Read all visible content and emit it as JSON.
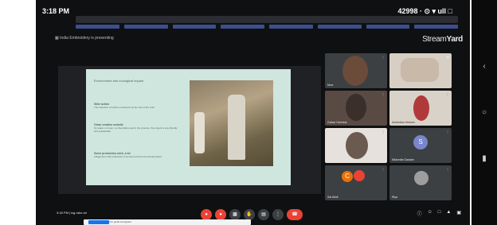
{
  "status_bar": {
    "time": "3:18 PM",
    "right_text": "42998 · ⊙ ▾ ull □"
  },
  "meet": {
    "presenting_label": "India Embroidery is presenting",
    "brand_prefix": "Stream",
    "brand_suffix": "Yard"
  },
  "slide": {
    "title": "Environment and ecological impact",
    "sections": [
      {
        "heading": "Slide action",
        "body": "The reduction of carbon emissions by the use of the craft"
      },
      {
        "heading": "Clean creation website",
        "body": "No water, no heat, no chemicals used in the process, the project is eco-friendly and sustainable"
      },
      {
        "heading": "Some production work, a lot",
        "body": "Indigenous craft production is women led and community based"
      }
    ]
  },
  "participants": [
    {
      "name": "Noor",
      "color": "#6b4b3a"
    },
    {
      "name": "",
      "color": "#c9b9a8"
    },
    {
      "name": "Gulzar Harmina",
      "color": "#3a2f2b"
    },
    {
      "name": "Ambedkar Hisham",
      "color": "#b03a3a"
    },
    {
      "name": "",
      "color": "#6a5a50"
    },
    {
      "name": "Nilasmita Gautam",
      "color": "#7986cb"
    },
    {
      "name": "Sai Akhil",
      "color": "#e8710a"
    },
    {
      "name": "Riya",
      "color": "#9e9e9e"
    }
  ],
  "avatars": {
    "s_letter": "S",
    "o_letter": "C"
  },
  "controls": {
    "clock": "3:18 PM | ixg-mkn-ctr",
    "end_call": "☎"
  },
  "banner": {
    "text": "Presentation control for gmail.com/guest"
  },
  "colors": {
    "background": "#0f1012",
    "tile": "#3c4043",
    "accent_red": "#ea4335",
    "slide_bg": "#cfe6df"
  }
}
